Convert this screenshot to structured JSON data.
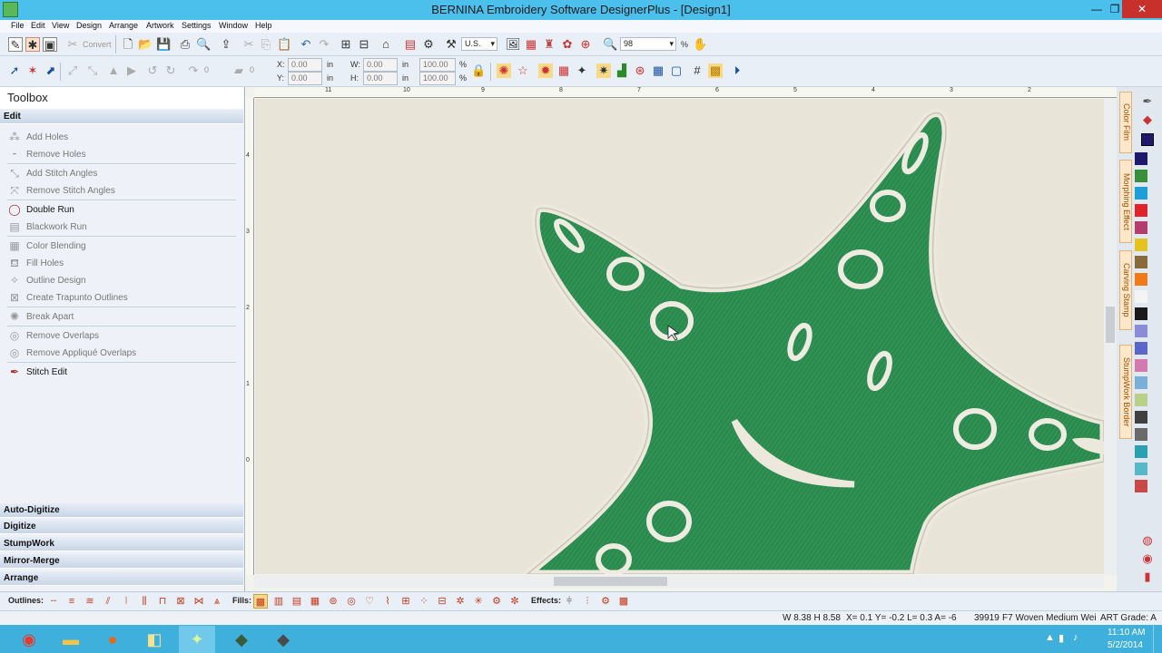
{
  "window": {
    "title": "BERNINA Embroidery Software DesignerPlus - [Design1]",
    "minimize": "—",
    "maximize": "❐",
    "close": "✕"
  },
  "menu": [
    "File",
    "Edit",
    "View",
    "Design",
    "Arrange",
    "Artwork",
    "Settings",
    "Window",
    "Help"
  ],
  "toolbar1": {
    "convert_label": "Convert",
    "unit_value": "U.S.",
    "zoom_value": "98",
    "zoom_unit": "%"
  },
  "toolbar2": {
    "rotate_value": "0",
    "skew_value": "0",
    "x_label": "X:",
    "x_value": "0.00",
    "x_unit": "in",
    "y_label": "Y:",
    "y_value": "0.00",
    "y_unit": "in",
    "w_label": "W:",
    "w_value": "0.00",
    "w_unit": "in",
    "h_label": "H:",
    "h_value": "0.00",
    "h_unit": "in",
    "wpct_value": "100.00",
    "hpct_value": "100.00",
    "pct_unit": "%"
  },
  "toolbox": {
    "title": "Toolbox",
    "edit_section": "Edit",
    "items": [
      {
        "label": "Add Holes",
        "active": false
      },
      {
        "label": "Remove Holes",
        "active": false
      },
      {
        "label": "Add Stitch Angles",
        "active": false
      },
      {
        "label": "Remove Stitch Angles",
        "active": false
      },
      {
        "label": "Double Run",
        "active": true
      },
      {
        "label": "Blackwork Run",
        "active": false
      },
      {
        "label": "Color Blending",
        "active": false
      },
      {
        "label": "Fill Holes",
        "active": false
      },
      {
        "label": "Outline Design",
        "active": false
      },
      {
        "label": "Create Trapunto Outlines",
        "active": false
      },
      {
        "label": "Break Apart",
        "active": false
      },
      {
        "label": "Remove Overlaps",
        "active": false
      },
      {
        "label": "Remove Appliqué Overlaps",
        "active": false
      },
      {
        "label": "Stitch Edit",
        "active": true
      }
    ],
    "sections": [
      "Auto-Digitize",
      "Digitize",
      "StumpWork",
      "Mirror-Merge",
      "Arrange"
    ]
  },
  "rulers": {
    "top": [
      "11",
      "10",
      "9",
      "8",
      "7",
      "6",
      "5",
      "4",
      "3",
      "2"
    ],
    "left": [
      "4",
      "3",
      "2",
      "1",
      "0"
    ]
  },
  "right_tabs": [
    "Color Film",
    "Morphing Effect",
    "Carving Stamp",
    "StumpWork Border"
  ],
  "palette": [
    "#1e1a6b",
    "#3a8f3a",
    "#1f9fd6",
    "#e0222a",
    "#b43d6f",
    "#e6c21e",
    "#8a6a3a",
    "#f07a1a",
    "#f4f4f4",
    "#1a1a1a",
    "#8b8bd6",
    "#5a66c8",
    "#d47ab0",
    "#7ab0d8",
    "#b8d088",
    "#404040",
    "#6a6a6a",
    "#2aa0b0",
    "#58b8c8",
    "#c84848"
  ],
  "bottombar": {
    "outlines_label": "Outlines:",
    "fills_label": "Fills:",
    "effects_label": "Effects:"
  },
  "status": {
    "size": "W 8.38 H 8.58",
    "coords": "X=   0.1 Y=  -0.2 L=    0.3 A= -6",
    "stitches": "39919",
    "fabric": "F7 Woven Medium Wei",
    "grade": "ART Grade: A"
  },
  "taskbar": {
    "time": "11:10 AM",
    "date": "5/2/2014",
    "apps": [
      "chrome-icon",
      "explorer-icon",
      "firefox-icon",
      "folder-icon",
      "bernina-icon",
      "app2-icon",
      "app3-icon"
    ]
  }
}
